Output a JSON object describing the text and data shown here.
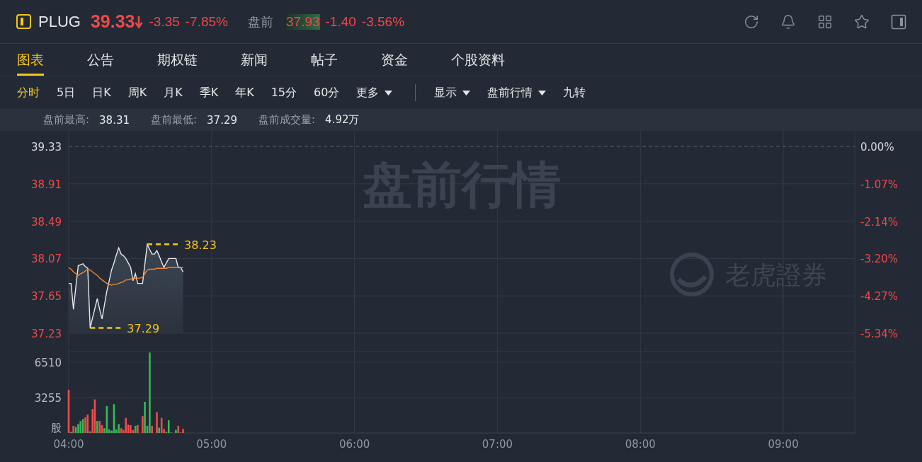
{
  "header": {
    "symbol": "PLUG",
    "price": "39.33",
    "change": "-3.35",
    "change_pct": "-7.85%",
    "premarket": {
      "label": "盘前",
      "price": "37.93",
      "flash": true,
      "change": "-1.40",
      "change_pct": "-3.56%"
    }
  },
  "tabs": [
    {
      "label": "图表",
      "selected": true
    },
    {
      "label": "公告",
      "selected": false
    },
    {
      "label": "期权链",
      "selected": false
    },
    {
      "label": "新闻",
      "selected": false
    },
    {
      "label": "帖子",
      "selected": false
    },
    {
      "label": "资金",
      "selected": false
    },
    {
      "label": "个股资料",
      "selected": false
    }
  ],
  "periods": [
    {
      "label": "分时",
      "kind": "option",
      "selected": true
    },
    {
      "label": "5日",
      "kind": "option",
      "selected": false
    },
    {
      "label": "日K",
      "kind": "option",
      "selected": false
    },
    {
      "label": "周K",
      "kind": "option",
      "selected": false
    },
    {
      "label": "月K",
      "kind": "option",
      "selected": false
    },
    {
      "label": "季K",
      "kind": "option",
      "selected": false
    },
    {
      "label": "年K",
      "kind": "option",
      "selected": false
    },
    {
      "label": "15分",
      "kind": "option",
      "selected": false
    },
    {
      "label": "60分",
      "kind": "option",
      "selected": false
    },
    {
      "label": "更多",
      "kind": "dropdown",
      "selected": false
    }
  ],
  "view_options": [
    {
      "label": "显示",
      "kind": "dropdown"
    },
    {
      "label": "盘前行情",
      "kind": "dropdown"
    },
    {
      "label": "九转",
      "kind": "option"
    }
  ],
  "stats": [
    {
      "label": "盘前最高:",
      "value": "38.31"
    },
    {
      "label": "盘前最低:",
      "value": "37.29"
    },
    {
      "label": "盘前成交量:",
      "value": "4.92万"
    }
  ],
  "price_chart": {
    "watermark": "盘前行情",
    "brand": "老虎證券",
    "percent_labels": [
      "0.00%",
      "-1.07%",
      "-2.14%",
      "-3.20%",
      "-4.27%",
      "-5.34%"
    ],
    "chart_data": {
      "type": "line",
      "grid": true,
      "categories": [
        null,
        null,
        null,
        null,
        null,
        null,
        null,
        null,
        null,
        null,
        null,
        null,
        null,
        null,
        null,
        null,
        null,
        null,
        null,
        null,
        null,
        null,
        null,
        null,
        null,
        null,
        null,
        null,
        null,
        null,
        null,
        null,
        null,
        null,
        null,
        null,
        null,
        null,
        null,
        null,
        null,
        null,
        null,
        null,
        null,
        null,
        null,
        null,
        null,
        null,
        null,
        null,
        null,
        null,
        null,
        null,
        null,
        null,
        null,
        null,
        null,
        null,
        null,
        null,
        null,
        null,
        null,
        null,
        null,
        null,
        null,
        null,
        null,
        null,
        null,
        null,
        null,
        null,
        null,
        null,
        null,
        null,
        null,
        null,
        null,
        null,
        null,
        null,
        null,
        null,
        null,
        null,
        null,
        null,
        null,
        null,
        null,
        null,
        null,
        null,
        null,
        null,
        null,
        null,
        null,
        null,
        null,
        null,
        null,
        null,
        null,
        null,
        null,
        null,
        null,
        null,
        null,
        null,
        null,
        null,
        null,
        null,
        null,
        null,
        null,
        null,
        null,
        null,
        null,
        null,
        null,
        null,
        null,
        null,
        null,
        null,
        null,
        null,
        null,
        null,
        null,
        null,
        null,
        null,
        null,
        null,
        null,
        null,
        null,
        null,
        null,
        null,
        null,
        null,
        null,
        null,
        null,
        null,
        null,
        null,
        null,
        null,
        null,
        null,
        null,
        null,
        null,
        null,
        null,
        null,
        null,
        null,
        null,
        null,
        null,
        null,
        null,
        null,
        null,
        null,
        null,
        null,
        null,
        null,
        null,
        null,
        null,
        null,
        null,
        null,
        null,
        null,
        null,
        null,
        null,
        null,
        null,
        null,
        null,
        null,
        null,
        null,
        null,
        null,
        null,
        null,
        null,
        null,
        null,
        null,
        null,
        null,
        null,
        null,
        null,
        null,
        null,
        null,
        null,
        null,
        null,
        null,
        null,
        null,
        null,
        null,
        null,
        null,
        null,
        null,
        null,
        null,
        null,
        null,
        null,
        null,
        null,
        null,
        null,
        null,
        null,
        null,
        null,
        null,
        null,
        null,
        null,
        null,
        null,
        null,
        null,
        null,
        null,
        null,
        null,
        null,
        null,
        null,
        null,
        null,
        null,
        null,
        null,
        null,
        null,
        null,
        null,
        null,
        null,
        null,
        null,
        null,
        null,
        null,
        null,
        null,
        null,
        null,
        null,
        null,
        null,
        null,
        null,
        null,
        null,
        null,
        null,
        null,
        null,
        null,
        null,
        null,
        null,
        null,
        null,
        null,
        null,
        null,
        null,
        null,
        null,
        null,
        null,
        null,
        null,
        null,
        null,
        null,
        null,
        null,
        null,
        null,
        null,
        null,
        null,
        null,
        null,
        null,
        null,
        null,
        null,
        null,
        null,
        null,
        null,
        null,
        null,
        null,
        null,
        null,
        null
      ],
      "series": [
        {
          "color": "#e8e8e8",
          "values": [
            37.79,
            37.79,
            37.5,
            37.75,
            37.99,
            38.0,
            38.01,
            37.98,
            37.96,
            37.29,
            37.4,
            37.51,
            37.62,
            37.5,
            37.39,
            37.55,
            37.7,
            37.82,
            37.94,
            38.02,
            38.11,
            38.19,
            38.12,
            38.1,
            38.07,
            38.02,
            37.97,
            37.82,
            37.9,
            37.79,
            37.79,
            37.79,
            38.01,
            38.23,
            38.17,
            38.12,
            38.12,
            38.16,
            38.1,
            38.03,
            37.97,
            38.02,
            38.07,
            38.07,
            38.07,
            38.07,
            37.97,
            37.97,
            37.92,
            null,
            null,
            null,
            null,
            null,
            null,
            null,
            null,
            null,
            null,
            null,
            null,
            null,
            null,
            null,
            null,
            null,
            null,
            null,
            null,
            null,
            null,
            null,
            null,
            null,
            null,
            null,
            null,
            null,
            null,
            null,
            null,
            null,
            null,
            null,
            null,
            null,
            null,
            null,
            null,
            null,
            null,
            null,
            null,
            null,
            null,
            null,
            null,
            null,
            null,
            null,
            null,
            null,
            null,
            null,
            null,
            null,
            null,
            null,
            null,
            null,
            null,
            null,
            null,
            null,
            null,
            null,
            null,
            null,
            null,
            null,
            null,
            null,
            null,
            null,
            null,
            null,
            null,
            null,
            null,
            null,
            null,
            null,
            null,
            null,
            null,
            null,
            null,
            null,
            null,
            null,
            null,
            null,
            null,
            null,
            null,
            null,
            null,
            null,
            null,
            null,
            null,
            null,
            null,
            null,
            null,
            null,
            null,
            null,
            null,
            null,
            null,
            null,
            null,
            null,
            null,
            null,
            null,
            null,
            null,
            null,
            null,
            null,
            null,
            null,
            null,
            null,
            null,
            null,
            null,
            null,
            null,
            null,
            null,
            null,
            null,
            null,
            null,
            null,
            null,
            null,
            null,
            null,
            null,
            null,
            null,
            null,
            null,
            null,
            null,
            null,
            null,
            null,
            null,
            null,
            null,
            null,
            null,
            null,
            null,
            null,
            null,
            null,
            null,
            null,
            null,
            null,
            null,
            null,
            null,
            null,
            null,
            null,
            null,
            null,
            null,
            null,
            null,
            null,
            null,
            null,
            null,
            null,
            null,
            null,
            null,
            null,
            null,
            null,
            null,
            null,
            null,
            null,
            null,
            null,
            null,
            null,
            null,
            null,
            null,
            null,
            null,
            null,
            null,
            null,
            null,
            null,
            null,
            null,
            null,
            null,
            null,
            null,
            null,
            null,
            null,
            null,
            null,
            null,
            null,
            null,
            null,
            null,
            null,
            null,
            null,
            null,
            null,
            null,
            null,
            null,
            null,
            null,
            null,
            null,
            null,
            null,
            null,
            null,
            null,
            null,
            null,
            null,
            null,
            null,
            null,
            null,
            null,
            null,
            null,
            null,
            null,
            null,
            null,
            null,
            null,
            null,
            null,
            null,
            null,
            null,
            null,
            null,
            null,
            null,
            null,
            null,
            null,
            null,
            null,
            null,
            null,
            null,
            null,
            null,
            null,
            null,
            null,
            null,
            null,
            null,
            null
          ]
        },
        {
          "color": "#f0892a",
          "values": [
            37.97,
            37.95,
            37.92,
            37.9,
            37.88,
            37.9,
            37.91,
            37.93,
            37.95,
            37.94,
            37.92,
            37.9,
            37.88,
            37.85,
            37.83,
            37.81,
            37.79,
            37.78,
            37.77,
            37.78,
            37.78,
            37.79,
            37.8,
            37.81,
            37.83,
            37.83,
            37.84,
            37.84,
            37.85,
            37.85,
            37.85,
            37.86,
            37.9,
            37.94,
            37.95,
            37.95,
            37.95,
            37.96,
            37.96,
            37.96,
            37.96,
            37.96,
            37.97,
            37.97,
            37.97,
            37.97,
            37.97,
            37.97,
            37.97,
            null,
            null,
            null,
            null,
            null,
            null,
            null,
            null,
            null,
            null,
            null,
            null,
            null,
            null,
            null,
            null,
            null,
            null,
            null,
            null,
            null,
            null,
            null,
            null,
            null,
            null,
            null,
            null,
            null,
            null,
            null,
            null,
            null,
            null,
            null,
            null,
            null,
            null,
            null,
            null,
            null,
            null,
            null,
            null,
            null,
            null,
            null,
            null,
            null,
            null,
            null,
            null,
            null,
            null,
            null,
            null,
            null,
            null,
            null,
            null,
            null,
            null,
            null,
            null,
            null,
            null,
            null,
            null,
            null,
            null,
            null,
            null,
            null,
            null,
            null,
            null,
            null,
            null,
            null,
            null,
            null,
            null,
            null,
            null,
            null,
            null,
            null,
            null,
            null,
            null,
            null,
            null,
            null,
            null,
            null,
            null,
            null,
            null,
            null,
            null,
            null,
            null,
            null,
            null,
            null,
            null,
            null,
            null,
            null,
            null,
            null,
            null,
            null,
            null,
            null,
            null,
            null,
            null,
            null,
            null,
            null,
            null,
            null,
            null,
            null,
            null,
            null,
            null,
            null,
            null,
            null,
            null,
            null,
            null,
            null,
            null,
            null,
            null,
            null,
            null,
            null,
            null,
            null,
            null,
            null,
            null,
            null,
            null,
            null,
            null,
            null,
            null,
            null,
            null,
            null,
            null,
            null,
            null,
            null,
            null,
            null,
            null,
            null,
            null,
            null,
            null,
            null,
            null,
            null,
            null,
            null,
            null,
            null,
            null,
            null,
            null,
            null,
            null,
            null,
            null,
            null,
            null,
            null,
            null,
            null,
            null,
            null,
            null,
            null,
            null,
            null,
            null,
            null,
            null,
            null,
            null,
            null,
            null,
            null,
            null,
            null,
            null,
            null,
            null,
            null,
            null,
            null,
            null,
            null,
            null,
            null,
            null,
            null,
            null,
            null,
            null,
            null,
            null,
            null,
            null,
            null,
            null,
            null,
            null,
            null,
            null,
            null,
            null,
            null,
            null,
            null,
            null,
            null,
            null,
            null,
            null,
            null,
            null,
            null,
            null,
            null,
            null,
            null,
            null,
            null,
            null,
            null,
            null,
            null,
            null,
            null,
            null,
            null,
            null,
            null,
            null,
            null,
            null,
            null,
            null,
            null,
            null,
            null,
            null,
            null,
            null,
            null,
            null,
            null,
            null,
            null,
            null,
            null,
            null,
            null,
            null,
            null,
            null,
            null,
            null,
            null,
            null
          ]
        }
      ],
      "ylim": [
        37.23,
        39.33
      ],
      "yticks": [
        39.33,
        38.91,
        38.49,
        38.07,
        37.65,
        37.23
      ],
      "annotations": [
        "38.23",
        "37.29"
      ]
    }
  },
  "volume_chart": {
    "chart_data": {
      "type": "bar",
      "stacked": true,
      "x": [
        4,
        4.017,
        4.033,
        4.05,
        4.067,
        4.083,
        4.1,
        4.117,
        4.133,
        4.15,
        4.167,
        4.183,
        4.2,
        4.217,
        4.233,
        4.25,
        4.267,
        4.283,
        4.3,
        4.317,
        4.333,
        4.35,
        4.367,
        4.383,
        4.4,
        4.417,
        4.433,
        4.45,
        4.467,
        4.483,
        4.5,
        4.517,
        4.533,
        4.55,
        4.567,
        4.583,
        4.6,
        4.617,
        4.633,
        4.65,
        4.667,
        4.683,
        4.7,
        4.717,
        4.733,
        4.75,
        4.767,
        4.783,
        4.8
      ],
      "series": [
        {
          "color": "#ef4b4b",
          "values": [
            3980,
            null,
            660,
            null,
            null,
            null,
            null,
            1440,
            1700,
            null,
            2210,
            3090,
            null,
            1100,
            730,
            null,
            null,
            null,
            null,
            null,
            null,
            null,
            440,
            290,
            1390,
            770,
            710,
            270,
            null,
            730,
            null,
            1550,
            null,
            null,
            null,
            660,
            null,
            1920,
            null,
            1390,
            380,
            null,
            null,
            null,
            null,
            null,
            660,
            null,
            380
          ]
        },
        {
          "color": "#35b955",
          "values": [
            null,
            110,
            null,
            550,
            820,
            1100,
            1280,
            null,
            null,
            150,
            null,
            null,
            1100,
            null,
            null,
            440,
            2480,
            330,
            220,
            2650,
            330,
            820,
            null,
            null,
            null,
            null,
            null,
            null,
            660,
            null,
            null,
            null,
            2870,
            660,
            7400,
            null,
            null,
            null,
            490,
            null,
            null,
            110,
            1170,
            40,
            null,
            290,
            null,
            40,
            null
          ]
        }
      ],
      "xlim": [
        4,
        9.5
      ],
      "ylim": [
        0,
        7490
      ],
      "yticks": [
        {
          "value": 0,
          "label": "股"
        },
        {
          "value": 3255,
          "label": "3255"
        },
        {
          "value": 6510,
          "label": "6510"
        }
      ],
      "xticks": [
        {
          "value": 4,
          "label": "04:00"
        },
        {
          "value": 5,
          "label": "05:00"
        },
        {
          "value": 6,
          "label": "06:00"
        },
        {
          "value": 7,
          "label": "07:00"
        },
        {
          "value": 8,
          "label": "08:00"
        },
        {
          "value": 9,
          "label": "09:00"
        }
      ]
    }
  }
}
